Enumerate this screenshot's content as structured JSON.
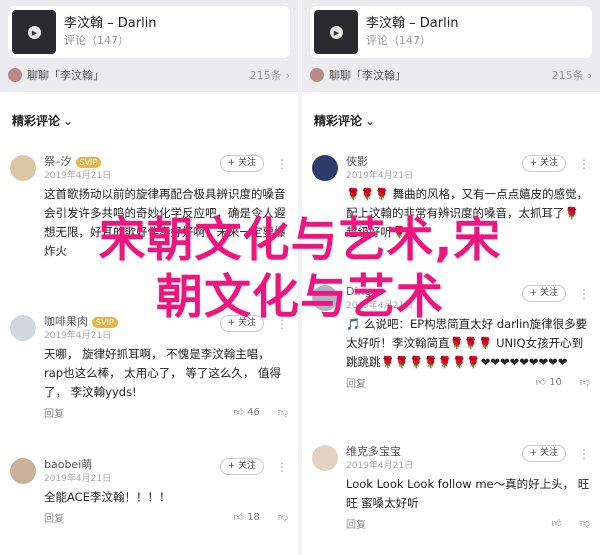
{
  "left": {
    "song": {
      "title": "李汶翰 – Darlin",
      "sub": "评论（147）"
    },
    "chat": {
      "label": "聊聊「李汶翰」",
      "count": "215条"
    },
    "section_title": "精彩评论",
    "comments": [
      {
        "name": "祭–汐",
        "badge": "SVIP",
        "time": "2019年4月21日",
        "follow": "+ 关注",
        "body": "这首歌扬动以前的旋律再配合极具辨识度的嗓音会引发许多共鸣的奇妙化学反应吧，确是令人遐想无限，好耳的歌好伴奏好好啊，未来一定要爆炸火",
        "reply": "回复",
        "like": "",
        "dislike": ""
      },
      {
        "name": "咖啡果肉",
        "badge": "SVIP",
        "time": "2019年4月21日",
        "follow": "+ 关注",
        "body": "天哪， 旋律好抓耳啊， 不愧是李汶翰主唱， rap也这么棒， 太用心了， 等了这么久， 值得了， 李汶翰yyds!",
        "reply": "回复",
        "like": "46",
        "dislike": ""
      },
      {
        "name": "baobei萌",
        "badge": "",
        "time": "2019年4月21日",
        "follow": "+ 关注",
        "body": "全能ACE李汶翰！！！！",
        "reply": "回复",
        "like": "18",
        "dislike": ""
      }
    ]
  },
  "right": {
    "song": {
      "title": "李汶翰 – Darlin",
      "sub": "评论（147）"
    },
    "chat": {
      "label": "聊聊「李汶翰」",
      "count": "215条"
    },
    "section_title": "精彩评论",
    "comments": [
      {
        "name": "俠影",
        "badge": "",
        "time": "2019年4月21日",
        "follow": "+ 关注",
        "body": "🌹🌹🌹 舞曲的风格，又有一点点嬉皮的感觉，配上汶翰的非常有辨识度的嗓音，太抓耳了🌹 超级好听🌹",
        "reply": "",
        "like": "",
        "dislike": ""
      },
      {
        "name": "Dinger",
        "badge": "",
        "time": "2019年4月21日",
        "follow": "+ 关注",
        "body": "🎵 么说吧：EP构思简直太好 darlin旋律很多要太好听！李汶翰简直🌹🌹🌹 UNIQ女孩开心到跳跳跳🌹🌹🌹🌹🌹🌹🌹❤❤❤❤❤❤❤❤❤",
        "reply": "回复",
        "like": "10",
        "dislike": ""
      },
      {
        "name": "维克多宝宝",
        "badge": "",
        "time": "2019年4月21日",
        "follow": "+ 关注",
        "body": "Look Look Look follow me～真的好上头， 旺旺 蜜嗓太好听",
        "reply": "回复",
        "like": "",
        "dislike": ""
      }
    ]
  },
  "overlay": {
    "line1": "宋朝文化与艺术,宋",
    "line2": "朝文化与艺术"
  },
  "colors": {
    "overlay": "#f0157e",
    "svip": "#e8b54a",
    "heart": "#e02020"
  },
  "icons": [
    "play-icon",
    "chevron-right-icon",
    "chevron-down-icon",
    "more-icon",
    "like-icon",
    "dislike-icon"
  ]
}
